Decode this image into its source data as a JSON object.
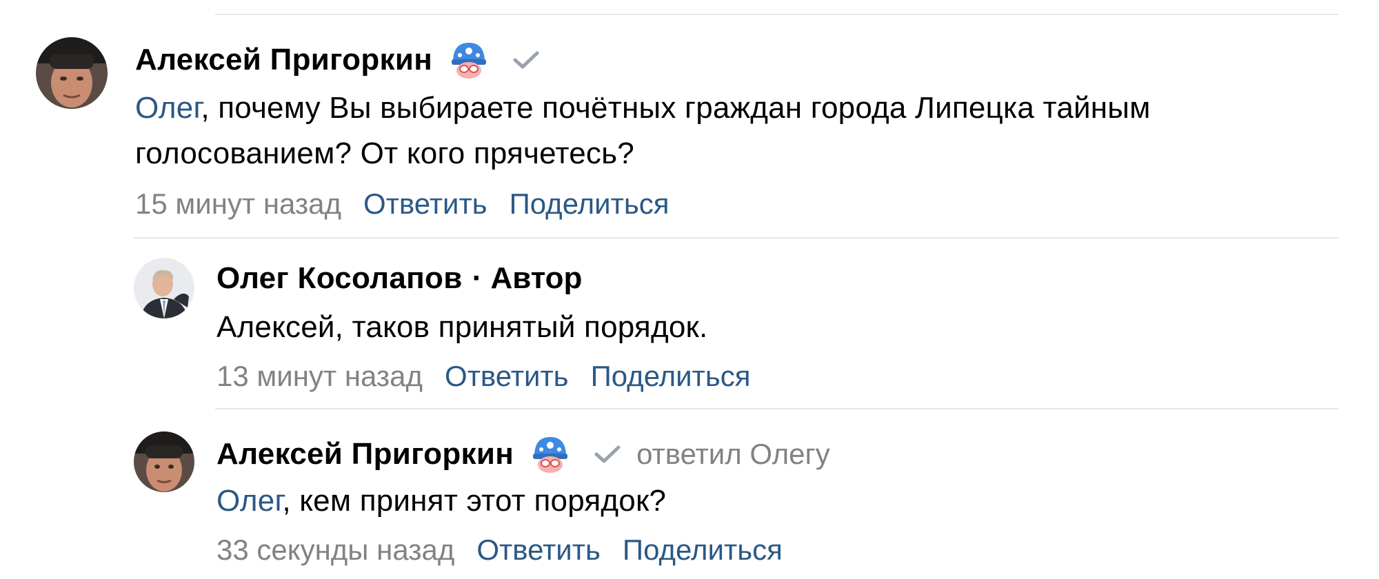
{
  "comments": [
    {
      "author": "Алексей Пригоркин",
      "mention": "Олег",
      "text": ", почему Вы выбираете почётных граждан города Липецка тайным голосованием? От кого прячетесь?",
      "timestamp": "15 минут назад",
      "reply_label": "Ответить",
      "share_label": "Поделиться",
      "icons": [
        "avatar-photo",
        "helmet-badge-icon",
        "verified-check-icon"
      ]
    },
    {
      "author": "Олег Косолапов",
      "author_suffix": "· Автор",
      "text": "Алексей, таков принятый порядок.",
      "timestamp": "13 минут назад",
      "reply_label": "Ответить",
      "share_label": "Поделиться",
      "icons": [
        "avatar-photo"
      ]
    },
    {
      "author": "Алексей Пригоркин",
      "reply_to": "ответил Олегу",
      "mention": "Олег",
      "text": ", кем принят этот порядок?",
      "timestamp": "33 секунды назад",
      "reply_label": "Ответить",
      "share_label": "Поделиться",
      "icons": [
        "avatar-photo",
        "helmet-badge-icon",
        "verified-check-icon"
      ]
    }
  ],
  "colors": {
    "link": "#2a5885",
    "meta": "#828282",
    "divider": "#e7e8ec",
    "badge": "#3f8ae0"
  }
}
